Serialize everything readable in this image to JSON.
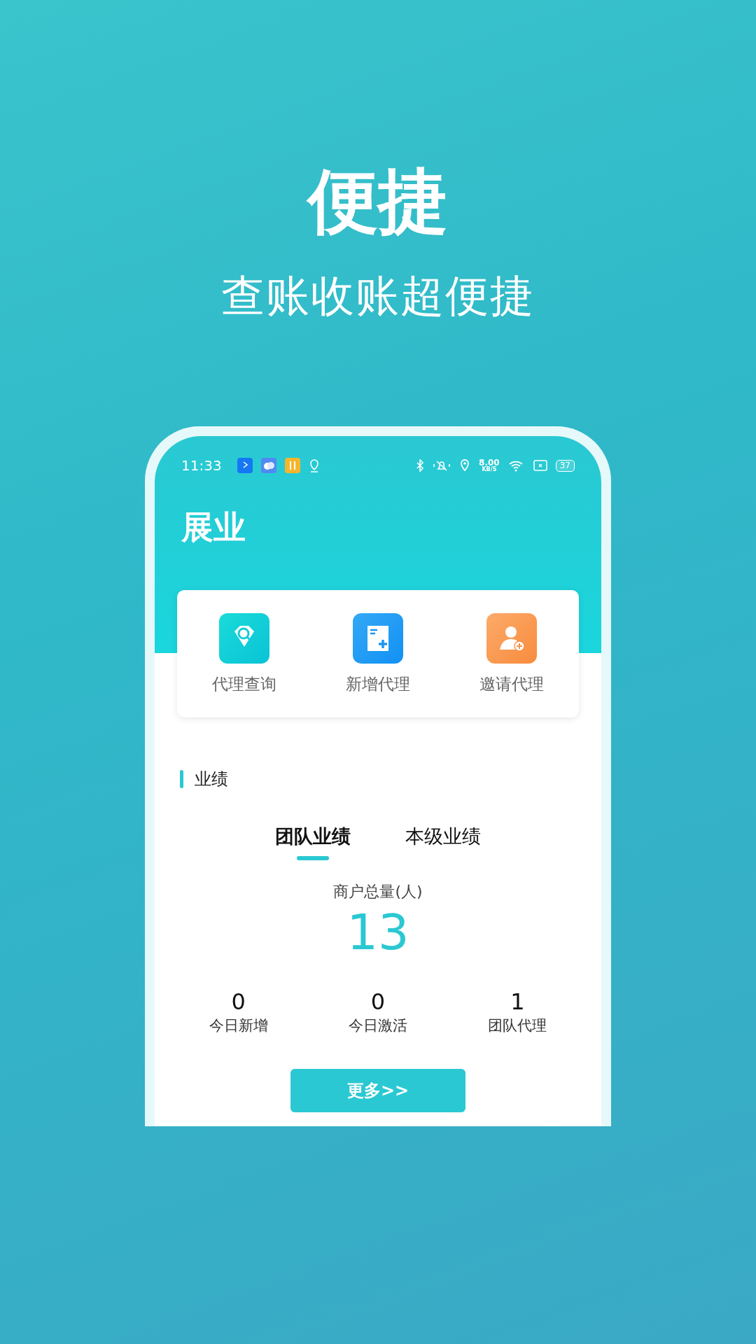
{
  "promo": {
    "headline": "便捷",
    "subtitle": "查账收账超便捷"
  },
  "status_bar": {
    "time": "11:33",
    "net_speed": "8.00",
    "net_unit": "KB/S",
    "battery": "37"
  },
  "header": {
    "title": "展业"
  },
  "quick_actions": [
    {
      "kind": "search",
      "label": "代理查询"
    },
    {
      "kind": "add-doc",
      "label": "新增代理"
    },
    {
      "kind": "invite",
      "label": "邀请代理"
    }
  ],
  "section": {
    "title": "业绩"
  },
  "tabs": [
    {
      "label": "团队业绩",
      "selected": true
    },
    {
      "label": "本级业绩",
      "selected": false
    }
  ],
  "total": {
    "label": "商户总量(人)",
    "value": "13"
  },
  "stats": [
    {
      "value": "0",
      "label": "今日新增"
    },
    {
      "value": "0",
      "label": "今日激活"
    },
    {
      "value": "1",
      "label": "团队代理"
    }
  ],
  "more_button": "更多>>"
}
